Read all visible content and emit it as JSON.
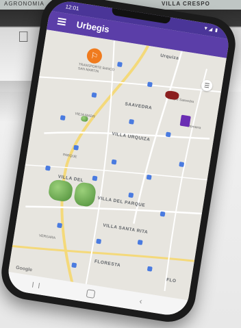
{
  "background": {
    "top_left_text": "AGRONOMIA",
    "top_right_text": "VILLA CRESPO"
  },
  "status_bar": {
    "time": "12:01",
    "icons": "▼◢ ▮"
  },
  "app_bar": {
    "title": "Urbegis"
  },
  "map": {
    "districts": [
      "Urquiza",
      "SAAVEDRA",
      "VILLA URQUIZA",
      "VILLA DEL PARQUE",
      "VILLA SANTA RITA",
      "FLORESTA",
      "FLO",
      "VILLA DEL"
    ],
    "small_labels": [
      "TRANSPORTE BANCO SAN MARTIN",
      "Parque Saavedra",
      "Fotomarra",
      "PARQUE",
      "VIEJA MADR",
      "VERGARA"
    ],
    "brand": "Google"
  },
  "colors": {
    "appbar": "#5b3ea8",
    "statusbar": "#4a3598",
    "fab": "#f07b1e",
    "poi": "#4a7be0"
  }
}
